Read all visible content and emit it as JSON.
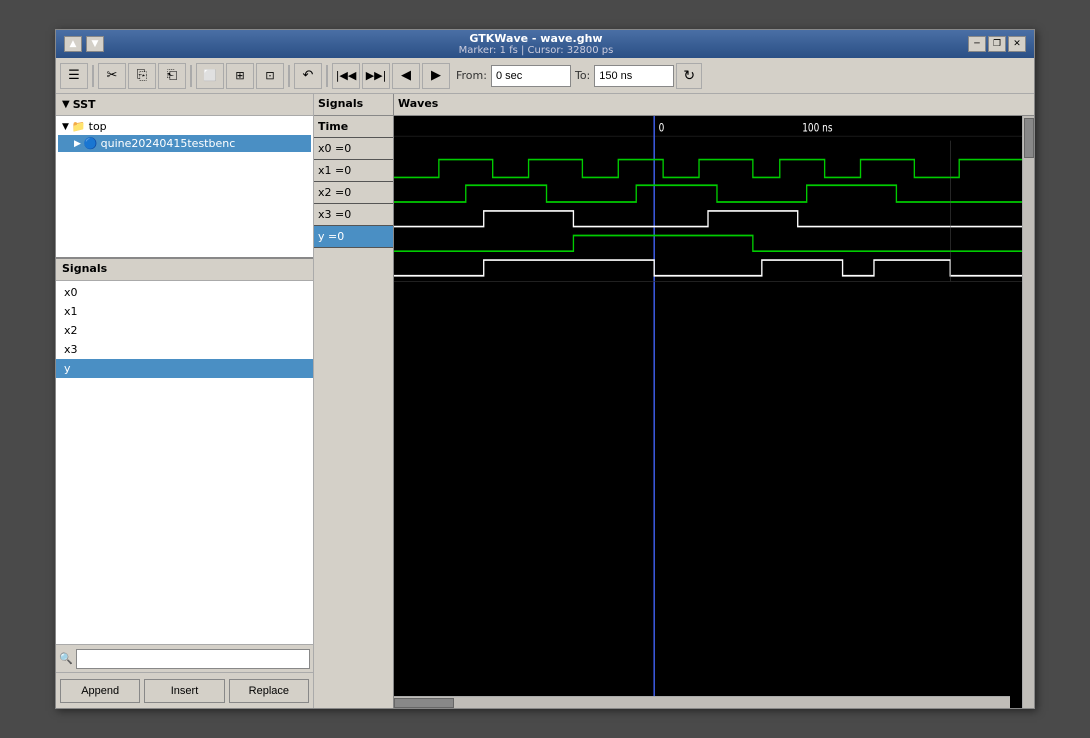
{
  "window": {
    "title": "GTKWave - wave.ghw",
    "subtitle": "Marker: 1 fs  |  Cursor: 32800 ps"
  },
  "titlebar": {
    "up_arrow": "▲",
    "down_arrow": "▼",
    "minimize_label": "🗕",
    "restore_label": "❐",
    "close_label": "✕"
  },
  "toolbar": {
    "hamburger": "☰",
    "cut": "✂",
    "copy": "⎘",
    "paste": "⎗",
    "select_all": "⬜",
    "zoom_fit": "⊞",
    "zoom_sel": "⊡",
    "undo": "↶",
    "rewind": "⏮",
    "fast_forward": "⏭",
    "prev": "◀",
    "next": "▶",
    "from_label": "From:",
    "from_value": "0 sec",
    "to_label": "To:",
    "to_value": "150 ns",
    "refresh": "↻"
  },
  "sst": {
    "header": "SST",
    "tree": [
      {
        "label": "top",
        "indent": 0,
        "expanded": true,
        "type": "folder"
      },
      {
        "label": "quine20240415testbenc",
        "indent": 1,
        "type": "module",
        "selected": true
      }
    ]
  },
  "signals_panel": {
    "header": "Signals",
    "items": [
      {
        "label": "x0",
        "selected": false
      },
      {
        "label": "x1",
        "selected": false
      },
      {
        "label": "x2",
        "selected": false
      },
      {
        "label": "x3",
        "selected": false
      },
      {
        "label": "y",
        "selected": true
      }
    ],
    "search_placeholder": ""
  },
  "buttons": [
    {
      "label": "Append",
      "name": "append-button"
    },
    {
      "label": "Insert",
      "name": "insert-button"
    },
    {
      "label": "Replace",
      "name": "replace-button"
    }
  ],
  "wave_signals": [
    {
      "label": "Time",
      "value": "",
      "is_time": true
    },
    {
      "label": "x0 =0",
      "highlighted": false
    },
    {
      "label": "x1 =0",
      "highlighted": false
    },
    {
      "label": "x2 =0",
      "highlighted": false
    },
    {
      "label": "x3 =0",
      "highlighted": false
    },
    {
      "label": "y =0",
      "highlighted": true
    }
  ],
  "time_markers": {
    "label_100ns": "100 ns",
    "label_pos": "0"
  },
  "colors": {
    "accent_blue": "#4a8fc4",
    "wave_green": "#00cc00",
    "wave_white": "#ffffff",
    "cursor_blue": "#4466ff",
    "bg_dark": "#000000",
    "bg_panel": "#d4d0c8"
  }
}
